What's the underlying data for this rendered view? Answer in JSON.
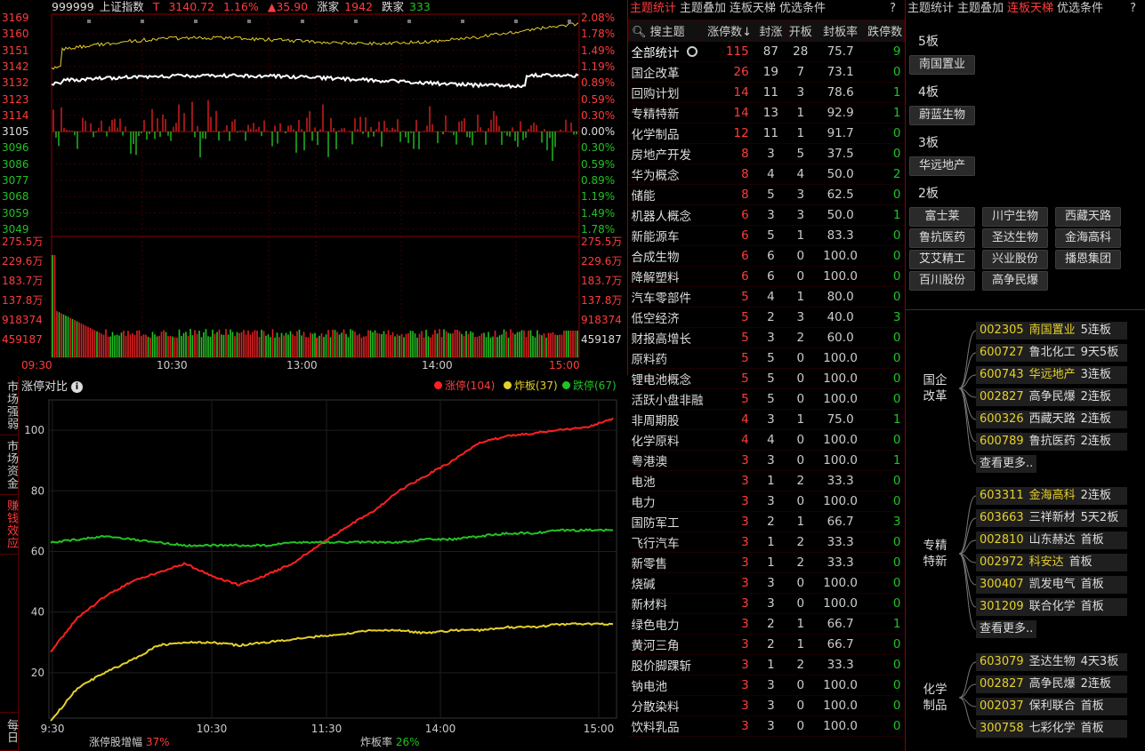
{
  "index_header": {
    "code": "999999",
    "name": "上证指数",
    "tag": "T",
    "price": "3140.72",
    "pct": "1.16%",
    "change": "▲35.90",
    "up_label": "涨家",
    "up_count": "1942",
    "down_label": "跌家",
    "down_count": "333"
  },
  "price_axis_left": [
    "3169",
    "3160",
    "3151",
    "3142",
    "3132",
    "3123",
    "3114",
    "3105",
    "3096",
    "3086",
    "3077",
    "3068",
    "3059",
    "3049"
  ],
  "price_axis_right": [
    "2.08%",
    "1.78%",
    "1.49%",
    "1.19%",
    "0.89%",
    "0.59%",
    "0.30%",
    "0.00%",
    "0.30%",
    "0.59%",
    "0.89%",
    "1.19%",
    "1.49%",
    "1.78%"
  ],
  "volume_axis": [
    "275.5万",
    "229.6万",
    "183.7万",
    "137.8万",
    "918374",
    "459187"
  ],
  "volume_axis_right_last": "459187",
  "time_axis": [
    "09:30",
    "10:30",
    "13:00",
    "14:00",
    "15:00"
  ],
  "zt_panel": {
    "title": "涨停对比",
    "legend": [
      {
        "label": "涨停(104)",
        "color": "#ff2020"
      },
      {
        "label": "炸板(37)",
        "color": "#e5d02a"
      },
      {
        "label": "跌停(67)",
        "color": "#22c222"
      }
    ],
    "side_tabs": [
      "市场强弱",
      "市场资金",
      "赚钱效应",
      "每日"
    ],
    "footer_left_label": "涨停股增幅",
    "footer_left_value": "37%",
    "footer_right_label": "炸板率",
    "footer_right_value": "26%"
  },
  "chart_data": {
    "type": "line",
    "x": [
      "9:30",
      "10:30",
      "11:30",
      "14:00",
      "15:00"
    ],
    "y_ticks": [
      20,
      40,
      60,
      80,
      100
    ],
    "ylim": [
      5,
      110
    ],
    "series": [
      {
        "name": "涨停",
        "color": "#ff2020",
        "values": [
          27,
          38,
          45,
          50,
          53,
          56,
          52,
          49,
          52,
          56,
          62,
          68,
          73,
          80,
          85,
          90,
          96,
          98,
          99,
          100,
          101,
          104
        ]
      },
      {
        "name": "炸板",
        "color": "#e5d02a",
        "values": [
          4,
          15,
          20,
          24,
          29,
          30,
          30,
          29,
          30,
          31,
          32,
          33,
          34,
          34,
          33,
          34,
          34,
          35,
          35,
          36,
          36,
          36
        ]
      },
      {
        "name": "跌停",
        "color": "#22c222",
        "values": [
          63,
          64,
          65,
          64,
          63,
          62,
          62,
          62,
          62,
          63,
          63,
          63,
          63,
          63,
          64,
          64,
          65,
          66,
          66,
          67,
          67,
          67
        ]
      }
    ]
  },
  "theme_tabs": [
    {
      "label": "主题统计",
      "active": true
    },
    {
      "label": "主题叠加",
      "active": false
    },
    {
      "label": "连板天梯",
      "active": false
    },
    {
      "label": "优选条件",
      "active": false
    }
  ],
  "help_mark": "?",
  "theme_columns": [
    "搜主题",
    "涨停数↓",
    "封涨",
    "开板",
    "封板率",
    "跌停数"
  ],
  "theme_rows": [
    [
      "全部统计",
      "115",
      "87",
      "28",
      "75.7",
      "9"
    ],
    [
      "国企改革",
      "26",
      "19",
      "7",
      "73.1",
      "0"
    ],
    [
      "回购计划",
      "14",
      "11",
      "3",
      "78.6",
      "1"
    ],
    [
      "专精特新",
      "14",
      "13",
      "1",
      "92.9",
      "1"
    ],
    [
      "化学制品",
      "12",
      "11",
      "1",
      "91.7",
      "0"
    ],
    [
      "房地产开发",
      "8",
      "3",
      "5",
      "37.5",
      "0"
    ],
    [
      "华为概念",
      "8",
      "4",
      "4",
      "50.0",
      "2"
    ],
    [
      "储能",
      "8",
      "5",
      "3",
      "62.5",
      "0"
    ],
    [
      "机器人概念",
      "6",
      "3",
      "3",
      "50.0",
      "1"
    ],
    [
      "新能源车",
      "6",
      "5",
      "1",
      "83.3",
      "0"
    ],
    [
      "合成生物",
      "6",
      "6",
      "0",
      "100.0",
      "0"
    ],
    [
      "降解塑料",
      "6",
      "6",
      "0",
      "100.0",
      "0"
    ],
    [
      "汽车零部件",
      "5",
      "4",
      "1",
      "80.0",
      "0"
    ],
    [
      "低空经济",
      "5",
      "2",
      "3",
      "40.0",
      "3"
    ],
    [
      "财报高增长",
      "5",
      "3",
      "2",
      "60.0",
      "0"
    ],
    [
      "原料药",
      "5",
      "5",
      "0",
      "100.0",
      "0"
    ],
    [
      "锂电池概念",
      "5",
      "5",
      "0",
      "100.0",
      "0"
    ],
    [
      "活跃小盘非融",
      "5",
      "5",
      "0",
      "100.0",
      "0"
    ],
    [
      "非周期股",
      "4",
      "3",
      "1",
      "75.0",
      "1"
    ],
    [
      "化学原料",
      "4",
      "4",
      "0",
      "100.0",
      "0"
    ],
    [
      "粤港澳",
      "3",
      "3",
      "0",
      "100.0",
      "1"
    ],
    [
      "电池",
      "3",
      "1",
      "2",
      "33.3",
      "0"
    ],
    [
      "电力",
      "3",
      "3",
      "0",
      "100.0",
      "0"
    ],
    [
      "国防军工",
      "3",
      "2",
      "1",
      "66.7",
      "3"
    ],
    [
      "飞行汽车",
      "3",
      "1",
      "2",
      "33.3",
      "0"
    ],
    [
      "新零售",
      "3",
      "1",
      "2",
      "33.3",
      "0"
    ],
    [
      "烧碱",
      "3",
      "3",
      "0",
      "100.0",
      "0"
    ],
    [
      "新材料",
      "3",
      "3",
      "0",
      "100.0",
      "0"
    ],
    [
      "绿色电力",
      "3",
      "2",
      "1",
      "66.7",
      "1"
    ],
    [
      "黄河三角",
      "3",
      "2",
      "1",
      "66.7",
      "0"
    ],
    [
      "股价脚踝斩",
      "3",
      "1",
      "2",
      "33.3",
      "0"
    ],
    [
      "钠电池",
      "3",
      "3",
      "0",
      "100.0",
      "0"
    ],
    [
      "分散染料",
      "3",
      "3",
      "0",
      "100.0",
      "0"
    ],
    [
      "饮料乳品",
      "3",
      "3",
      "0",
      "100.0",
      "0"
    ]
  ],
  "ladder_tabs": [
    {
      "label": "主题统计",
      "active": false
    },
    {
      "label": "主题叠加",
      "active": false
    },
    {
      "label": "连板天梯",
      "active": true
    },
    {
      "label": "优选条件",
      "active": false
    }
  ],
  "ladder": [
    {
      "level": "5板",
      "stocks": [
        "南国置业"
      ]
    },
    {
      "level": "4板",
      "stocks": [
        "蔚蓝生物"
      ]
    },
    {
      "level": "3板",
      "stocks": [
        "华远地产"
      ]
    },
    {
      "level": "2板",
      "stocks": [
        "富士莱",
        "川宁生物",
        "西藏天路",
        "鲁抗医药",
        "圣达生物",
        "金海高科",
        "艾艾精工",
        "兴业股份",
        "播恩集团",
        "百川股份",
        "高争民爆"
      ]
    }
  ],
  "groups": [
    {
      "name": "国企改革",
      "stocks": [
        {
          "code": "002305",
          "name": "南国置业",
          "tag": "5连板",
          "hl": true
        },
        {
          "code": "600727",
          "name": "鲁北化工",
          "tag": "9天5板",
          "hl": false
        },
        {
          "code": "600743",
          "name": "华远地产",
          "tag": "3连板",
          "hl": true
        },
        {
          "code": "002827",
          "name": "高争民爆",
          "tag": "2连板",
          "hl": false
        },
        {
          "code": "600326",
          "name": "西藏天路",
          "tag": "2连板",
          "hl": false
        },
        {
          "code": "600789",
          "name": "鲁抗医药",
          "tag": "2连板",
          "hl": false
        }
      ]
    },
    {
      "name": "专精特新",
      "stocks": [
        {
          "code": "603311",
          "name": "金海高科",
          "tag": "2连板",
          "hl": true
        },
        {
          "code": "603663",
          "name": "三祥新材",
          "tag": "5天2板",
          "hl": false
        },
        {
          "code": "002810",
          "name": "山东赫达",
          "tag": "首板",
          "hl": false
        },
        {
          "code": "002972",
          "name": "科安达",
          "tag": "首板",
          "hl": true
        },
        {
          "code": "300407",
          "name": "凯发电气",
          "tag": "首板",
          "hl": false
        },
        {
          "code": "301209",
          "name": "联合化学",
          "tag": "首板",
          "hl": false
        }
      ]
    },
    {
      "name": "化学制品",
      "stocks": [
        {
          "code": "603079",
          "name": "圣达生物",
          "tag": "4天3板",
          "hl": false
        },
        {
          "code": "002827",
          "name": "高争民爆",
          "tag": "2连板",
          "hl": false
        },
        {
          "code": "002037",
          "name": "保利联合",
          "tag": "首板",
          "hl": false
        },
        {
          "code": "300758",
          "name": "七彩化学",
          "tag": "首板",
          "hl": false
        }
      ]
    }
  ],
  "more_label": "查看更多.."
}
